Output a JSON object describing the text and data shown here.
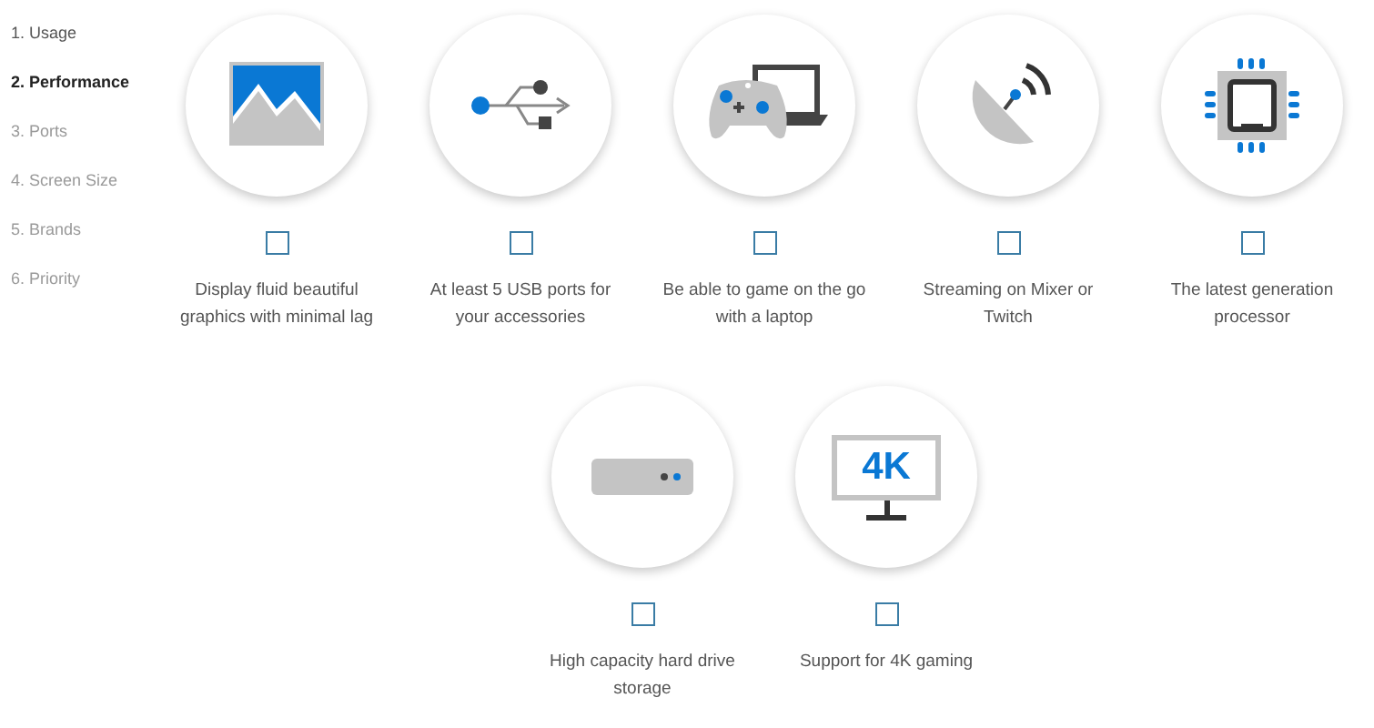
{
  "steps": [
    {
      "label": "1. Usage",
      "selected": false,
      "completed": true
    },
    {
      "label": "2. Performance",
      "selected": true,
      "completed": false
    },
    {
      "label": "3. Ports",
      "selected": false,
      "completed": false
    },
    {
      "label": "4. Screen Size",
      "selected": false,
      "completed": false
    },
    {
      "label": "5. Brands",
      "selected": false,
      "completed": false
    },
    {
      "label": "6. Priority",
      "selected": false,
      "completed": false
    }
  ],
  "options": [
    {
      "kind": "display",
      "label": "Display fluid beautiful graphics with minimal lag",
      "checked": false
    },
    {
      "kind": "usb",
      "label": "At least 5 USB ports for your accessories",
      "checked": false
    },
    {
      "kind": "gaming",
      "label": "Be able to game on the go with a laptop",
      "checked": false
    },
    {
      "kind": "streaming",
      "label": "Streaming on Mixer or Twitch",
      "checked": false
    },
    {
      "kind": "processor",
      "label": "The latest generation processor",
      "checked": false
    },
    {
      "kind": "storage",
      "label": "High capacity hard drive storage",
      "checked": false
    },
    {
      "kind": "monitor",
      "label": "Support for 4K gaming",
      "checked": false,
      "screen_text": "4K"
    }
  ]
}
